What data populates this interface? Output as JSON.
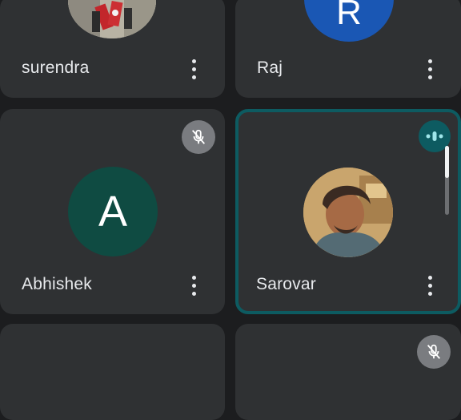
{
  "participants": [
    {
      "name": "surendra",
      "avatar": {
        "type": "photo",
        "icon": "press-photo-avatar"
      },
      "muted": false
    },
    {
      "name": "Raj",
      "avatar": {
        "type": "initial",
        "initial": "R",
        "color": "#1a57b4"
      },
      "muted": false
    },
    {
      "name": "Abhishek",
      "avatar": {
        "type": "initial",
        "initial": "A",
        "color": "#0f4b42"
      },
      "muted": true
    },
    {
      "name": "Sarovar",
      "avatar": {
        "type": "photo",
        "icon": "profile-photo-avatar"
      },
      "muted": false,
      "speaking": true
    },
    {
      "name": "",
      "muted": false
    },
    {
      "name": "",
      "muted": true
    }
  ],
  "colors": {
    "background": "#1c1d1f",
    "tile": "#2f3133",
    "active_border": "#0d5b61",
    "text": "#e8eaed",
    "mute_badge": "#7a7c80"
  },
  "icons": {
    "more": "more-vert-icon",
    "mute": "mic-off-icon",
    "speaking": "audio-level-icon"
  }
}
